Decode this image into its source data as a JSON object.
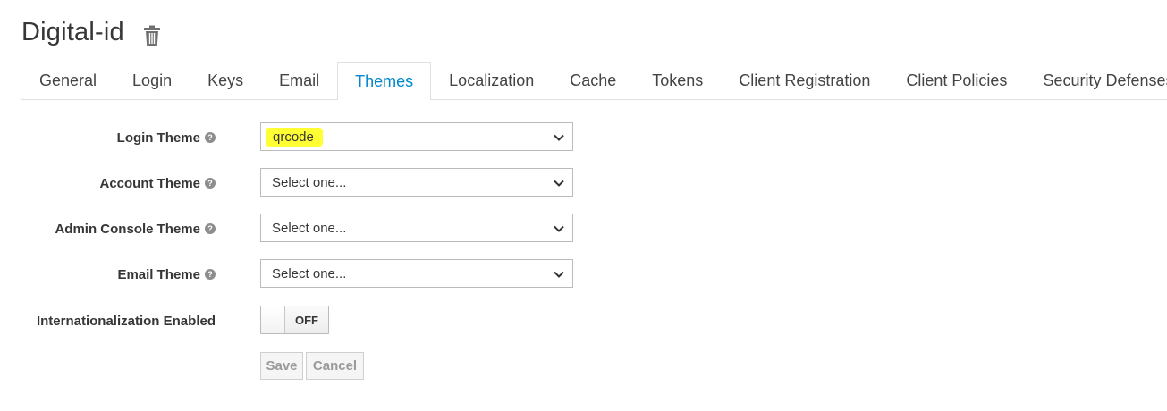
{
  "header": {
    "title": "Digital-id",
    "delete_icon": "trash-icon"
  },
  "tabs": [
    {
      "label": "General"
    },
    {
      "label": "Login"
    },
    {
      "label": "Keys"
    },
    {
      "label": "Email"
    },
    {
      "label": "Themes",
      "active": true
    },
    {
      "label": "Localization"
    },
    {
      "label": "Cache"
    },
    {
      "label": "Tokens"
    },
    {
      "label": "Client Registration"
    },
    {
      "label": "Client Policies"
    },
    {
      "label": "Security Defenses"
    }
  ],
  "form": {
    "login_theme": {
      "label": "Login Theme",
      "value": "qrcode"
    },
    "account_theme": {
      "label": "Account Theme",
      "value": "Select one..."
    },
    "admin_console_theme": {
      "label": "Admin Console Theme",
      "value": "Select one..."
    },
    "email_theme": {
      "label": "Email Theme",
      "value": "Select one..."
    },
    "internationalization": {
      "label": "Internationalization Enabled",
      "state": "OFF"
    },
    "help_icon": "question-circle-icon",
    "save_label": "Save",
    "cancel_label": "Cancel"
  },
  "colors": {
    "accent": "#0088ce",
    "highlight": "#ffff33"
  }
}
